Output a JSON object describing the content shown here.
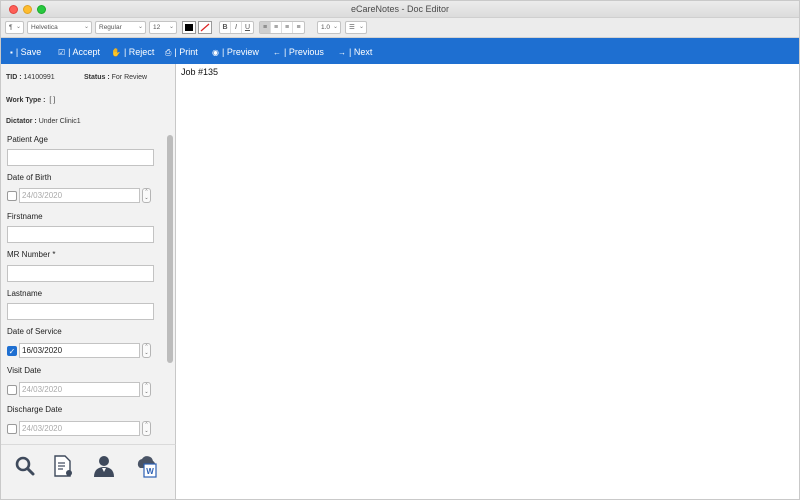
{
  "window": {
    "title": "eCareNotes - Doc Editor"
  },
  "format_toolbar": {
    "paragraph_glyph": "¶",
    "font_family": "Helvetica",
    "font_style": "Regular",
    "font_size": "12",
    "bold": "B",
    "italic": "I",
    "underline": "U",
    "line_spacing": "1.0",
    "list_glyph": "☰",
    "text_color": "#000000"
  },
  "actions": [
    {
      "icon": "save-icon",
      "label": "| Save"
    },
    {
      "icon": "accept-icon",
      "label": "| Accept"
    },
    {
      "icon": "reject-icon",
      "label": "| Reject"
    },
    {
      "icon": "print-icon",
      "label": "| Print"
    },
    {
      "icon": "preview-icon",
      "label": "| Preview"
    },
    {
      "icon": "previous-icon",
      "label": "| Previous"
    },
    {
      "icon": "next-icon",
      "label": "| Next"
    }
  ],
  "job_info": {
    "tid_label": "TID :",
    "tid_value": "14100991",
    "status_label": "Status :",
    "status_value": "For Review",
    "worktype_label": "Work Type :",
    "worktype_value": "[ ]",
    "dictator_label": "Dictator :",
    "dictator_value": "Under Clinic1"
  },
  "form": {
    "patient_age_label": "Patient Age",
    "dob_label": "Date of Birth",
    "dob_value": "24/03/2020",
    "firstname_label": "Firstname",
    "mr_number_label": "MR Number *",
    "lastname_label": "Lastname",
    "dos_label": "Date of Service",
    "dos_value": "16/03/2020",
    "visit_date_label": "Visit Date",
    "visit_date_value": "24/03/2020",
    "discharge_date_label": "Discharge Date",
    "discharge_date_value": "24/03/2020"
  },
  "footer_icons": [
    "search-icon",
    "document-settings-icon",
    "doctor-icon",
    "cloud-word-icon"
  ],
  "editor": {
    "text": "Job #135"
  },
  "colors": {
    "accent": "#1e6fd1",
    "panel": "#f2f2f2"
  }
}
